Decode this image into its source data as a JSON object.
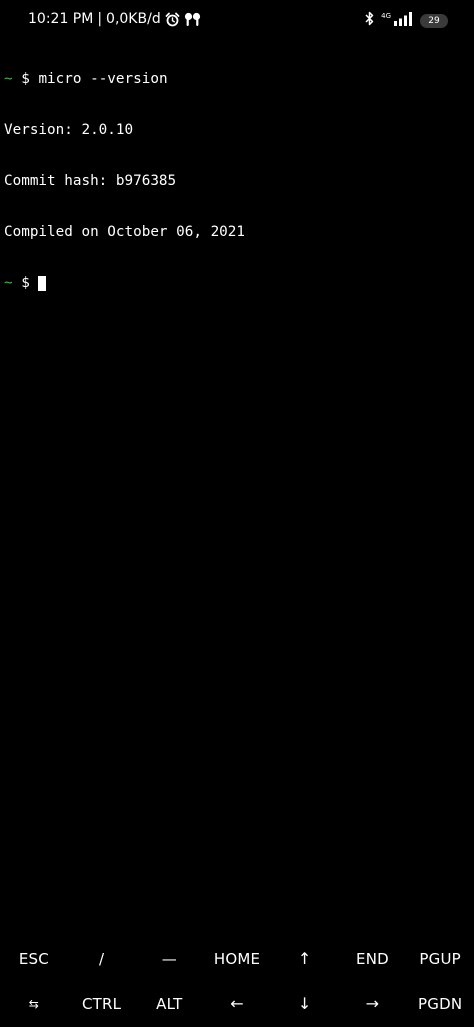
{
  "status_bar": {
    "time": "10:21 PM",
    "separator": "|",
    "data_rate": "0,0KB/d",
    "alarm_icon": "alarm-clock-icon",
    "earbuds_icon": "earbuds-icon",
    "bluetooth_icon": "bluetooth-icon",
    "network_type": "4G",
    "signal_icon": "signal-bars-icon",
    "battery_level": "29"
  },
  "terminal": {
    "prompt_symbol": "~",
    "prompt_sign": "$",
    "lines": [
      {
        "kind": "command",
        "text": "micro --version"
      },
      {
        "kind": "output",
        "text": "Version: 2.0.10"
      },
      {
        "kind": "output",
        "text": "Commit hash: b976385"
      },
      {
        "kind": "output",
        "text": "Compiled on October 06, 2021"
      },
      {
        "kind": "prompt",
        "text": ""
      }
    ],
    "colors": {
      "background": "#000000",
      "text": "#ffffff",
      "prompt_tilde": "#4caf50",
      "cursor": "#ffffff"
    }
  },
  "extra_keys": {
    "row1": [
      "ESC",
      "/",
      "—",
      "HOME",
      "↑",
      "END",
      "PGUP"
    ],
    "row2": [
      "⇆",
      "CTRL",
      "ALT",
      "←",
      "↓",
      "→",
      "PGDN"
    ]
  }
}
